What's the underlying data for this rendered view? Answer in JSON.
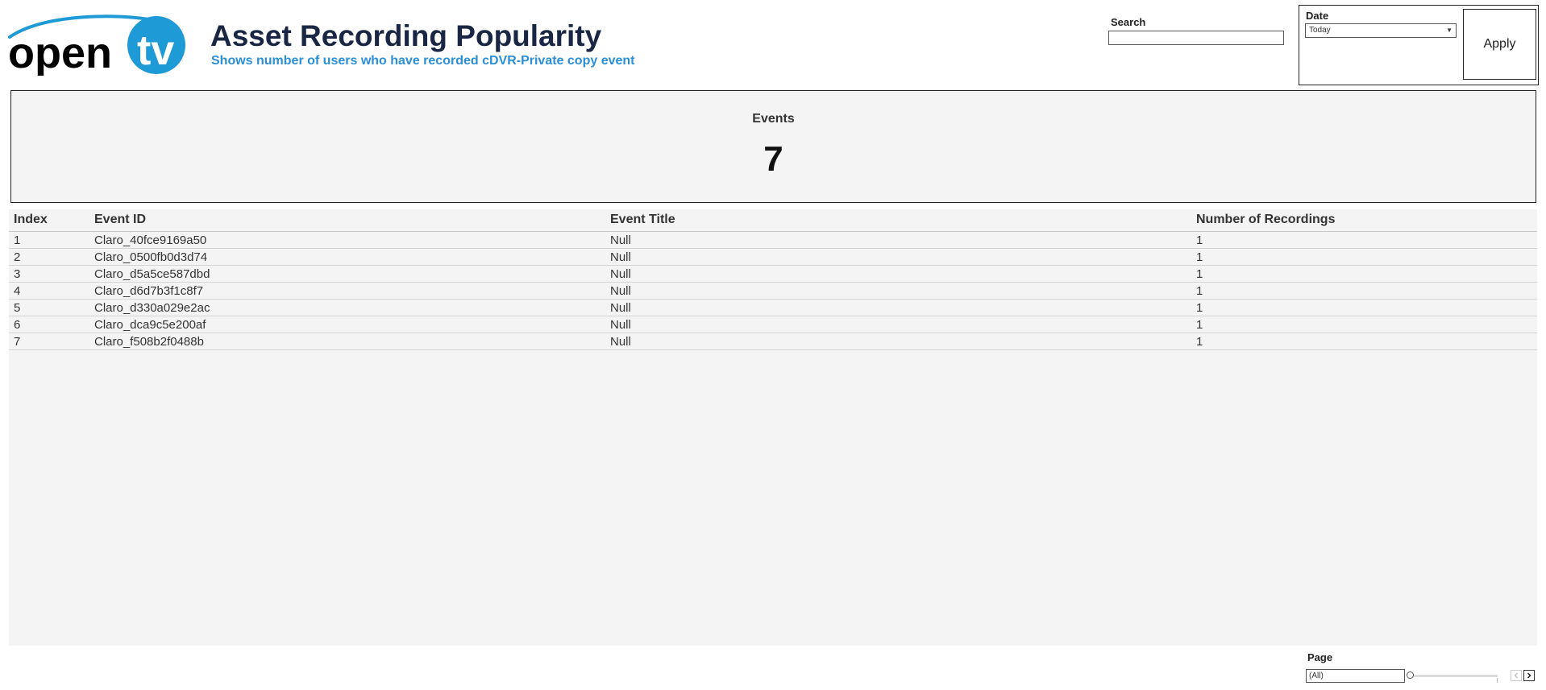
{
  "brand": {
    "logo_text": "open tv"
  },
  "header": {
    "title": "Asset Recording Popularity",
    "subtitle": "Shows number of users who have recorded cDVR-Private copy event"
  },
  "search": {
    "label": "Search",
    "value": ""
  },
  "filters": {
    "date_label": "Date",
    "date_value": "Today",
    "apply_label": "Apply"
  },
  "kpi": {
    "label": "Events",
    "value": "7"
  },
  "table": {
    "columns": [
      "Index",
      "Event ID",
      "Event Title",
      "Number of Recordings"
    ],
    "rows": [
      [
        "1",
        "Claro_40fce9169a50",
        "Null",
        "1"
      ],
      [
        "2",
        "Claro_0500fb0d3d74",
        "Null",
        "1"
      ],
      [
        "3",
        "Claro_d5a5ce587dbd",
        "Null",
        "1"
      ],
      [
        "4",
        "Claro_d6d7b3f1c8f7",
        "Null",
        "1"
      ],
      [
        "5",
        "Claro_d330a029e2ac",
        "Null",
        "1"
      ],
      [
        "6",
        "Claro_dca9c5e200af",
        "Null",
        "1"
      ],
      [
        "7",
        "Claro_f508b2f0488b",
        "Null",
        "1"
      ]
    ]
  },
  "pager": {
    "label": "Page",
    "value": "(All)"
  },
  "colors": {
    "title": "#1a2744",
    "subtitle": "#2a8fd6",
    "logo_blue": "#1e9ad6",
    "panel_bg": "#f4f4f4"
  }
}
